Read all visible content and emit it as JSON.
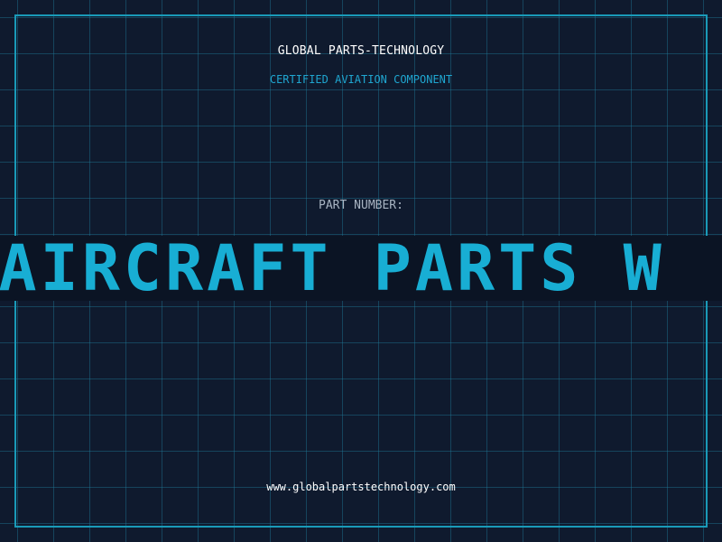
{
  "header": {
    "company": "GLOBAL PARTS-TECHNOLOGY",
    "tagline": "CERTIFIED AVIATION COMPONENT"
  },
  "part": {
    "label": "PART NUMBER:",
    "marquee": "ER AIRCRAFT PARTS W"
  },
  "footer": {
    "url": "www.globalpartstechnology.com"
  },
  "colors": {
    "background": "#0f1a2e",
    "grid": "#1e6f86",
    "accent": "#18aed4",
    "border": "#1a9ab8"
  }
}
